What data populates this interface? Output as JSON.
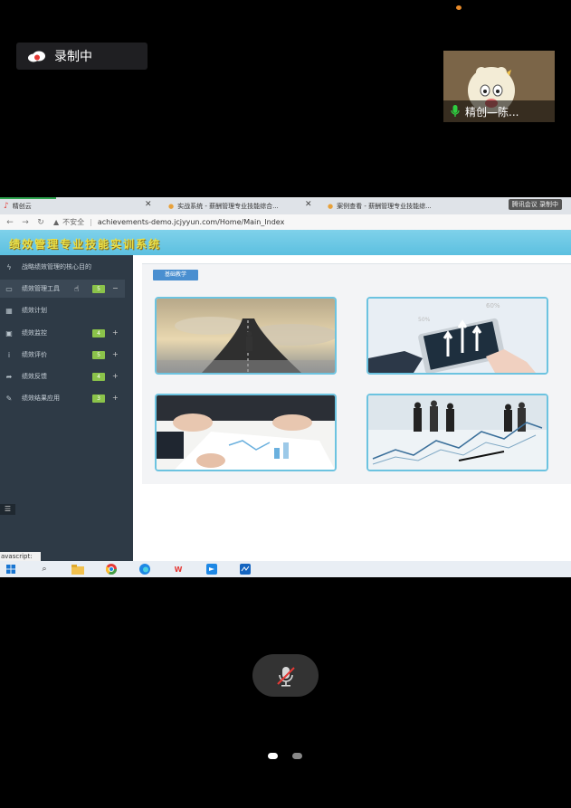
{
  "meeting": {
    "recording_label": "录制中",
    "participant_name": "精创—陈...",
    "colors": {
      "background": "#000000",
      "recording_badge": "#1f1f22",
      "participant_tile": "#7b6548",
      "mic_active": "#2ecc40",
      "mute_button": "#333333"
    },
    "icons": {
      "recording": "cloud-record-icon",
      "participant_mic": "mic-on-icon",
      "mute": "mic-muted-icon"
    },
    "pager": {
      "pages": 2,
      "current": 1
    }
  },
  "browser": {
    "tabs": [
      {
        "label": "精创云",
        "icon": "jingchuang-logo-icon"
      },
      {
        "label": "实战系统 - 薪酬管理专业技能综合...",
        "icon": "page-icon"
      },
      {
        "label": "案例查看 - 薪酬管理专业技能综...",
        "icon": "page-icon"
      }
    ],
    "meeting_chip": "腾讯会议  录制中",
    "url_warning": "不安全",
    "url": "achievements-demo.jcjyyun.com/Home/Main_Index"
  },
  "app": {
    "title": "绩效管理专业技能实训系统",
    "sidebar": {
      "items": [
        {
          "label": "战略绩效管理的核心目的",
          "icon": "bolt-icon",
          "badge": "",
          "toggle": ""
        },
        {
          "label": "绩效管理工具",
          "icon": "monitor-icon",
          "badge": "5",
          "toggle": "−"
        },
        {
          "label": "绩效计划",
          "icon": "calendar-icon",
          "badge": "",
          "toggle": ""
        },
        {
          "label": "绩效监控",
          "icon": "film-icon",
          "badge": "4",
          "toggle": "+"
        },
        {
          "label": "绩效评价",
          "icon": "info-icon",
          "badge": "5",
          "toggle": "+"
        },
        {
          "label": "绩效反馈",
          "icon": "share-icon",
          "badge": "4",
          "toggle": "+"
        },
        {
          "label": "绩效结果应用",
          "icon": "pencil-icon",
          "badge": "3",
          "toggle": "+"
        }
      ],
      "status_text": "avascript:"
    },
    "section_button": "基础教学",
    "cards": [
      {
        "image": "businessman-road-image"
      },
      {
        "image": "tablet-arrows-image"
      },
      {
        "image": "meeting-charts-image"
      },
      {
        "image": "business-people-graph-image"
      }
    ],
    "colors": {
      "banner": "#5cc0e0",
      "title_text": "#e9e04a",
      "sidebar": "#2e3a46",
      "badge": "#8bc34a",
      "section_button": "#4a8fd0",
      "card_border": "#6cc3e0"
    }
  },
  "taskbar": {
    "icons": [
      "windows-start-icon",
      "search-icon",
      "file-explorer-icon",
      "chrome-icon",
      "edge-icon",
      "wps-icon",
      "tencent-meeting-icon",
      "app-icon"
    ]
  }
}
